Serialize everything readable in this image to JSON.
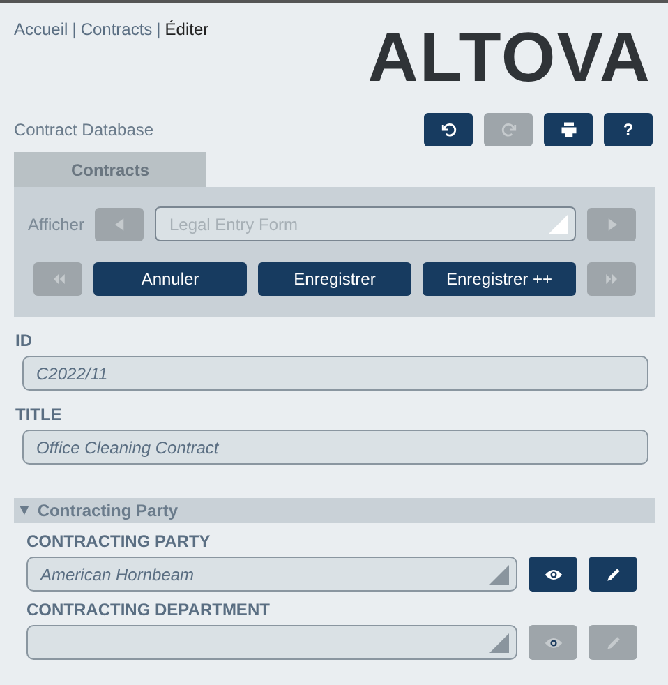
{
  "breadcrumb": [
    {
      "label": "Accueil",
      "selected": false
    },
    {
      "label": "Contracts",
      "selected": false
    },
    {
      "label": "Éditer",
      "selected": true
    }
  ],
  "breadcrumb_separator": "|",
  "logo": "ALTOVA",
  "app_title": "Contract Database",
  "toolbar": [
    {
      "kind": "undo",
      "disabled": false
    },
    {
      "kind": "redo",
      "disabled": true
    },
    {
      "kind": "print",
      "disabled": false
    },
    {
      "kind": "help",
      "label": "?",
      "disabled": false
    }
  ],
  "tabs": [
    {
      "label": "Contracts",
      "selected": true
    }
  ],
  "view": {
    "label": "Afficher",
    "value": "Legal Entry Form",
    "prev_disabled": true,
    "next_disabled": true
  },
  "actions": [
    {
      "kind": "first",
      "disabled": true
    },
    {
      "kind": "text",
      "label": "Annuler",
      "disabled": false
    },
    {
      "kind": "text",
      "label": "Enregistrer",
      "disabled": false
    },
    {
      "kind": "text",
      "label": "Enregistrer ++",
      "disabled": false
    },
    {
      "kind": "last",
      "disabled": true
    }
  ],
  "fields": [
    {
      "label": "ID",
      "value": "C2022/11"
    },
    {
      "label": "TITLE",
      "value": "Office Cleaning Contract"
    }
  ],
  "section": {
    "title": "Contracting Party",
    "expanded_icon": "▼",
    "expanded": true,
    "fields": [
      {
        "label": "CONTRACTING PARTY",
        "value": "American Hornbeam",
        "disabled": false
      },
      {
        "label": "CONTRACTING DEPARTMENT",
        "disabled": true
      }
    ]
  }
}
